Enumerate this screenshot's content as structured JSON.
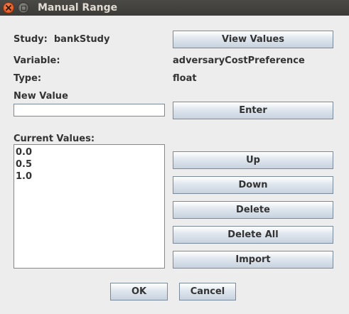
{
  "window": {
    "title": "Manual Range"
  },
  "study": {
    "label": "Study:",
    "value": "bankStudy"
  },
  "variable": {
    "label": "Variable:",
    "value": "adversaryCostPreference"
  },
  "type": {
    "label": "Type:",
    "value": "float"
  },
  "new_value": {
    "label": "New Value",
    "value": ""
  },
  "current_values": {
    "label": "Current Values:",
    "items": [
      "0.0",
      "0.5",
      "1.0"
    ]
  },
  "buttons": {
    "view_values": "View Values",
    "enter": "Enter",
    "up": "Up",
    "down": "Down",
    "delete": "Delete",
    "delete_all": "Delete All",
    "import": "Import",
    "ok": "OK",
    "cancel": "Cancel"
  }
}
